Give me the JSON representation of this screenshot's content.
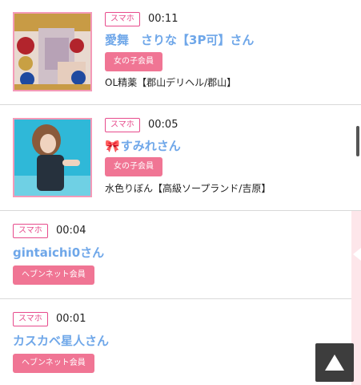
{
  "feed": {
    "entries": [
      {
        "device": "スマホ",
        "time": "00:11",
        "name": "愛舞　さりな【3P可】さん",
        "badge": "女の子会員",
        "shop": "OL精薬【郡山デリヘル/郡山】"
      },
      {
        "device": "スマホ",
        "time": "00:05",
        "ribbon": "🎀",
        "name": "すみれさん",
        "badge": "女の子会員",
        "shop": "水色りぼん【高級ソープランド/吉原】"
      },
      {
        "device": "スマホ",
        "time": "00:04",
        "name": "gintaichi0さん",
        "badge": "ヘブンネット会員"
      },
      {
        "device": "スマホ",
        "time": "00:01",
        "name": "カスカベ星人さん",
        "badge": "ヘブンネット会員"
      }
    ]
  },
  "colors": {
    "device_border": "#e74b8c",
    "name": "#6fa7e9",
    "badge_bg": "#f07594",
    "thumb_border": "#f49ab8",
    "side_strip": "#fde6ea",
    "top_button": "#3d3d3d"
  },
  "icons": {
    "scroll_top": "arrow-up-icon",
    "side_tab": "chevron-left-icon"
  }
}
